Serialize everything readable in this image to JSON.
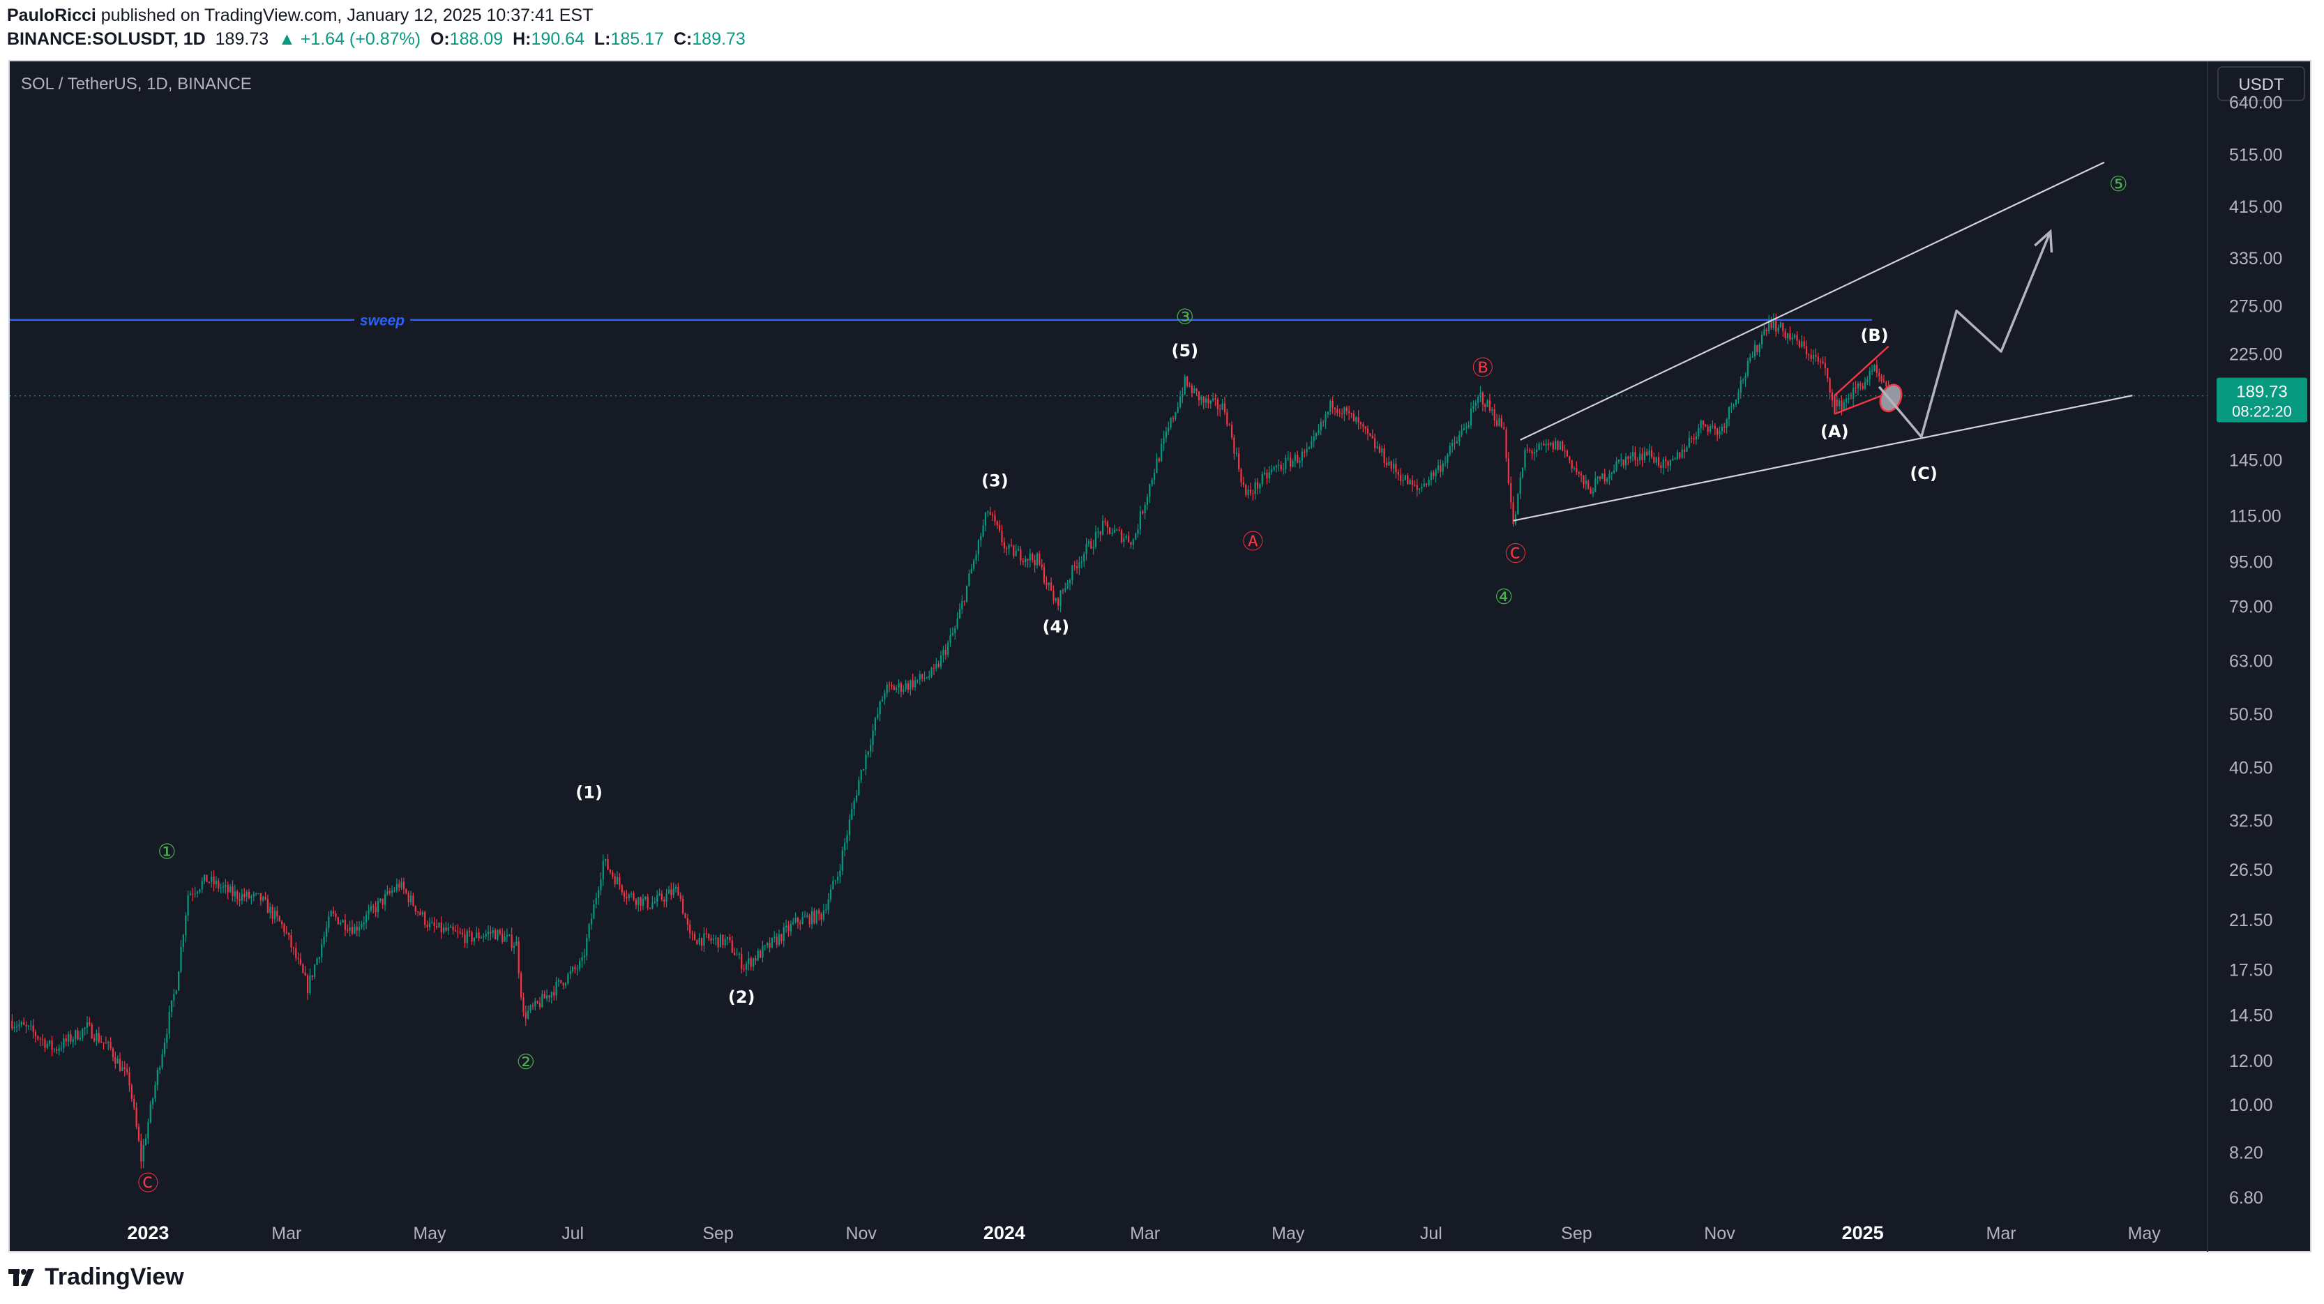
{
  "header": {
    "author": "PauloRicci",
    "published": " published on TradingView.com, January 12, 2025 10:37:41 EST",
    "symbol": "BINANCE:SOLUSDT, 1D",
    "last": "189.73",
    "change": "▲ +1.64 (+0.87%)",
    "o_label": "O:",
    "o": "188.09",
    "h_label": "H:",
    "h": "190.64",
    "l_label": "L:",
    "l": "185.17",
    "c_label": "C:",
    "c": "189.73"
  },
  "chart_data": {
    "type": "candlestick",
    "title": "SOL / TetherUS, 1D, BINANCE",
    "currency": "USDT",
    "y_scale": "log",
    "ylim": [
      6.2,
      760
    ],
    "y_ticks": [
      "640.00",
      "515.00",
      "415.00",
      "335.00",
      "275.00",
      "225.00",
      "145.00",
      "115.00",
      "95.00",
      "79.00",
      "63.00",
      "50.50",
      "40.50",
      "32.50",
      "26.50",
      "21.50",
      "17.50",
      "14.50",
      "12.00",
      "10.00",
      "8.20",
      "6.80"
    ],
    "x_ticks": [
      "2023",
      "Mar",
      "May",
      "Jul",
      "Sep",
      "Nov",
      "2024",
      "Mar",
      "May",
      "Jul",
      "Sep",
      "Nov",
      "2025",
      "Mar",
      "May"
    ],
    "x_tick_dates": [
      "2023-01-01",
      "2023-03-01",
      "2023-05-01",
      "2023-07-01",
      "2023-09-01",
      "2023-11-01",
      "2024-01-01",
      "2024-03-01",
      "2024-05-01",
      "2024-07-01",
      "2024-09-01",
      "2024-11-01",
      "2025-01-01",
      "2025-03-01",
      "2025-05-01"
    ],
    "bold_x_ticks": [
      "2023",
      "2024",
      "2025"
    ],
    "xlim": [
      "2022-11-03",
      "2025-05-28"
    ],
    "price_path": [
      [
        "2022-11-03",
        14.2
      ],
      [
        "2022-11-12",
        13.6
      ],
      [
        "2022-11-22",
        12.6
      ],
      [
        "2022-12-06",
        13.8
      ],
      [
        "2022-12-16",
        12.6
      ],
      [
        "2022-12-24",
        11.0
      ],
      [
        "2022-12-29",
        8.0
      ],
      [
        "2023-01-06",
        12.0
      ],
      [
        "2023-01-13",
        16.5
      ],
      [
        "2023-01-18",
        24.0
      ],
      [
        "2023-01-26",
        25.5
      ],
      [
        "2023-02-06",
        24.0
      ],
      [
        "2023-02-18",
        23.5
      ],
      [
        "2023-02-28",
        20.8
      ],
      [
        "2023-03-10",
        16.3
      ],
      [
        "2023-03-20",
        22.0
      ],
      [
        "2023-03-30",
        20.8
      ],
      [
        "2023-04-18",
        25.0
      ],
      [
        "2023-05-01",
        21.0
      ],
      [
        "2023-05-18",
        20.0
      ],
      [
        "2023-05-28",
        20.5
      ],
      [
        "2023-06-07",
        19.5
      ],
      [
        "2023-06-10",
        14.5
      ],
      [
        "2023-06-15",
        15.0
      ],
      [
        "2023-06-25",
        16.5
      ],
      [
        "2023-07-05",
        18.0
      ],
      [
        "2023-07-14",
        27.5
      ],
      [
        "2023-07-24",
        24.0
      ],
      [
        "2023-08-03",
        23.0
      ],
      [
        "2023-08-15",
        24.5
      ],
      [
        "2023-08-20",
        20.0
      ],
      [
        "2023-09-05",
        19.7
      ],
      [
        "2023-09-12",
        17.8
      ],
      [
        "2023-09-22",
        19.2
      ],
      [
        "2023-10-05",
        21.5
      ],
      [
        "2023-10-15",
        22.0
      ],
      [
        "2023-10-22",
        26.0
      ],
      [
        "2023-10-31",
        38.5
      ],
      [
        "2023-11-11",
        56.0
      ],
      [
        "2023-11-20",
        57.0
      ],
      [
        "2023-12-02",
        60.0
      ],
      [
        "2023-12-11",
        72.0
      ],
      [
        "2023-12-25",
        118.0
      ],
      [
        "2024-01-02",
        100.0
      ],
      [
        "2024-01-15",
        96.0
      ],
      [
        "2024-01-23",
        80.0
      ],
      [
        "2024-02-01",
        95.0
      ],
      [
        "2024-02-12",
        110.0
      ],
      [
        "2024-02-25",
        104.0
      ],
      [
        "2024-03-05",
        140.0
      ],
      [
        "2024-03-18",
        200.0
      ],
      [
        "2024-03-26",
        185.0
      ],
      [
        "2024-04-04",
        180.0
      ],
      [
        "2024-04-13",
        125.0
      ],
      [
        "2024-04-25",
        140.0
      ],
      [
        "2024-05-10",
        150.0
      ],
      [
        "2024-05-20",
        185.0
      ],
      [
        "2024-05-30",
        170.0
      ],
      [
        "2024-06-15",
        140.0
      ],
      [
        "2024-06-25",
        128.0
      ],
      [
        "2024-07-05",
        142.0
      ],
      [
        "2024-07-15",
        165.0
      ],
      [
        "2024-07-22",
        190.0
      ],
      [
        "2024-08-01",
        165.0
      ],
      [
        "2024-08-05",
        110.0
      ],
      [
        "2024-08-10",
        150.0
      ],
      [
        "2024-08-25",
        155.0
      ],
      [
        "2024-09-06",
        128.0
      ],
      [
        "2024-09-20",
        145.0
      ],
      [
        "2024-10-01",
        150.0
      ],
      [
        "2024-10-10",
        140.0
      ],
      [
        "2024-10-25",
        170.0
      ],
      [
        "2024-11-01",
        163.0
      ],
      [
        "2024-11-10",
        200.0
      ],
      [
        "2024-11-22",
        260.0
      ],
      [
        "2024-12-05",
        235.0
      ],
      [
        "2024-12-15",
        215.0
      ],
      [
        "2024-12-21",
        180.0
      ],
      [
        "2025-01-06",
        210.0
      ],
      [
        "2025-01-12",
        189.73
      ]
    ],
    "last_price": "189.73",
    "countdown": "08:22:20",
    "sweep": {
      "label": "sweep",
      "price": 260,
      "from": "2022-11-03",
      "to": "2025-01-05"
    },
    "channel": {
      "upper": [
        [
          "2024-08-08",
          158
        ],
        [
          "2025-04-14",
          500
        ]
      ],
      "lower": [
        [
          "2024-08-05",
          113
        ],
        [
          "2025-04-26",
          190
        ]
      ]
    },
    "small_channel": {
      "upper": [
        [
          "2024-12-20",
          190
        ],
        [
          "2025-01-12",
          233
        ]
      ],
      "lower": [
        [
          "2024-12-20",
          176
        ],
        [
          "2025-01-12",
          192
        ]
      ]
    },
    "projection": [
      [
        "2025-01-08",
        197
      ],
      [
        "2025-01-26",
        160
      ],
      [
        "2025-02-10",
        270
      ],
      [
        "2025-03-01",
        228
      ],
      [
        "2025-03-22",
        375
      ]
    ],
    "annotations": [
      {
        "text": "①",
        "date": "2023-01-09",
        "price": 28.5,
        "color": "#4caf50"
      },
      {
        "text": "②",
        "date": "2023-06-11",
        "price": 11.9,
        "color": "#4caf50"
      },
      {
        "text": "③",
        "date": "2024-03-18",
        "price": 262,
        "color": "#4caf50"
      },
      {
        "text": "④",
        "date": "2024-08-01",
        "price": 82,
        "color": "#4caf50"
      },
      {
        "text": "⑤",
        "date": "2025-04-20",
        "price": 455,
        "color": "#4caf50"
      },
      {
        "text": "Ⓒ",
        "date": "2023-01-01",
        "price": 7.2,
        "color": "#f23645"
      },
      {
        "text": "Ⓐ",
        "date": "2024-04-16",
        "price": 103,
        "color": "#f23645"
      },
      {
        "text": "Ⓑ",
        "date": "2024-07-23",
        "price": 212,
        "color": "#f23645"
      },
      {
        "text": "Ⓒ",
        "date": "2024-08-06",
        "price": 98,
        "color": "#f23645"
      },
      {
        "text": "(1)",
        "date": "2023-07-08",
        "price": 36.5,
        "color": "#ffffff"
      },
      {
        "text": "(2)",
        "date": "2023-09-11",
        "price": 15.6,
        "color": "#ffffff"
      },
      {
        "text": "(3)",
        "date": "2023-12-28",
        "price": 133,
        "color": "#ffffff"
      },
      {
        "text": "(4)",
        "date": "2024-01-23",
        "price": 72.5,
        "color": "#ffffff"
      },
      {
        "text": "(5)",
        "date": "2024-03-18",
        "price": 228,
        "color": "#ffffff"
      },
      {
        "text": "(A)",
        "date": "2024-12-20",
        "price": 163,
        "color": "#ffffff"
      },
      {
        "text": "(B)",
        "date": "2025-01-06",
        "price": 243,
        "color": "#ffffff"
      },
      {
        "text": "(C)",
        "date": "2025-01-27",
        "price": 137,
        "color": "#ffffff"
      }
    ],
    "colors": {
      "up": "#089981",
      "down": "#f23645",
      "sweep": "#2962ff",
      "trend": "#d1d4dc",
      "last": "#089981"
    }
  },
  "footer": {
    "brand": "TradingView"
  }
}
